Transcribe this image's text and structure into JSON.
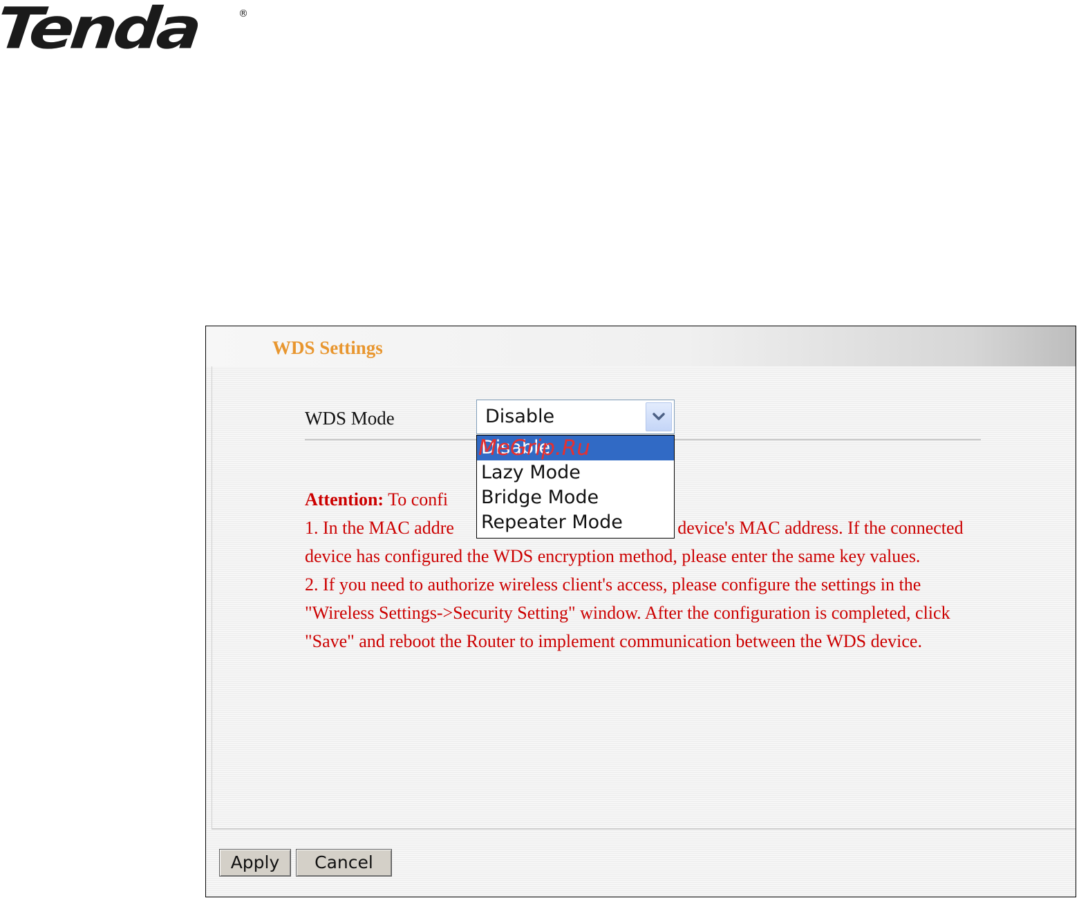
{
  "brand": {
    "logo_text": "Tenda",
    "registered_mark": "®"
  },
  "panel": {
    "title": "WDS Settings"
  },
  "wds_mode": {
    "label": "WDS Mode",
    "selected_value": "Disable",
    "options": [
      "Disable",
      "Lazy Mode",
      "Bridge Mode",
      "Repeater Mode"
    ]
  },
  "watermark": "MeGrip.Ru",
  "attention": {
    "heading": "Attention:",
    "intro": "To confi",
    "line1_a": "1. In the MAC addre",
    "line1_b": "ected device's MAC address. If the connected device has configured the WDS encryption method, please enter the same key values.",
    "line2": "2. If you need to authorize wireless client's access, please configure the settings in the \"Wireless Settings->Security Setting\" window. After the configuration is completed, click \"Save\" and reboot the Router to implement communication between the WDS device."
  },
  "buttons": {
    "apply": "Apply",
    "cancel": "Cancel"
  },
  "colors": {
    "title": "#e8962f",
    "attention": "#cc0000",
    "selected": "#316ac5"
  },
  "icons": {
    "select_arrow": "chevron-down-icon"
  }
}
